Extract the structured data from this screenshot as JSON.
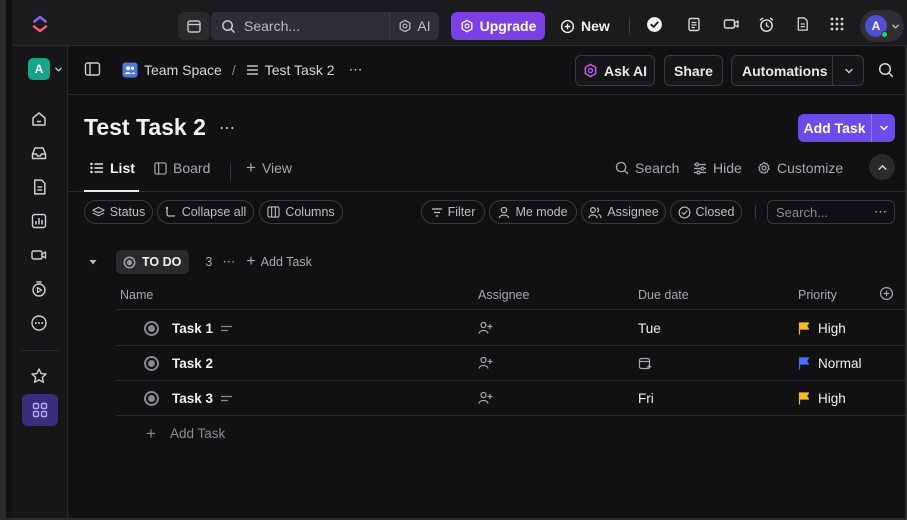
{
  "topbar": {
    "search_placeholder": "Search...",
    "ai_label": "AI",
    "upgrade_label": "Upgrade",
    "new_label": "New",
    "avatar_initial": "A"
  },
  "rail": {
    "workspace_initial": "A"
  },
  "breadcrumb": {
    "space": "Team Space",
    "separator": "/",
    "list": "Test Task 2"
  },
  "header_actions": {
    "ask_ai": "Ask AI",
    "share": "Share",
    "automations": "Automations"
  },
  "page": {
    "title": "Test Task 2",
    "add_task": "Add Task"
  },
  "views": {
    "list": "List",
    "board": "Board",
    "add_view": "View",
    "search": "Search",
    "hide": "Hide",
    "customize": "Customize"
  },
  "filters": {
    "status": "Status",
    "collapse_all": "Collapse all",
    "columns": "Columns",
    "filter": "Filter",
    "me_mode": "Me mode",
    "assignee": "Assignee",
    "closed": "Closed",
    "search_placeholder": "Search..."
  },
  "group": {
    "status": "TO DO",
    "count": "3",
    "add_task": "Add Task"
  },
  "table": {
    "columns": {
      "name": "Name",
      "assignee": "Assignee",
      "due": "Due date",
      "priority": "Priority"
    },
    "rows": [
      {
        "name": "Task 1",
        "due": "Tue",
        "priority": "High",
        "priority_color": "#f5b82e"
      },
      {
        "name": "Task 2",
        "due": "",
        "priority": "Normal",
        "priority_color": "#4c6ef5"
      },
      {
        "name": "Task 3",
        "due": "Fri",
        "priority": "High",
        "priority_color": "#f5b82e"
      }
    ],
    "add_task": "Add Task"
  }
}
